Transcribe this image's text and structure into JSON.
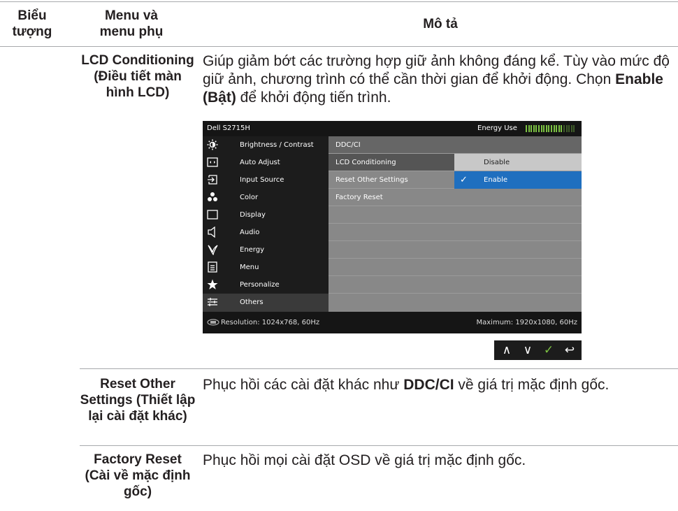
{
  "header": {
    "col1": "Biểu tượng",
    "col2": "Menu và menu phụ",
    "col3": "Mô tả"
  },
  "rows": [
    {
      "label": "LCD Conditioning (Điều tiết màn hình LCD)",
      "desc_pre": "Giúp giảm bớt các trường hợp giữ ảnh không đáng kể. Tùy vào mức độ giữ ảnh, chương trình có thể cần thời gian để khởi động. Chọn ",
      "desc_bold": "Enable (Bật)",
      "desc_post": " để khởi động tiến trình."
    },
    {
      "label": "Reset Other Settings (Thiết lập lại cài đặt khác)",
      "desc_pre": "Phục hồi các cài đặt khác như ",
      "desc_bold": "DDC/CI",
      "desc_post": " về giá trị mặc định gốc."
    },
    {
      "label": "Factory Reset (Cài về mặc định gốc)",
      "desc_pre": "Phục hồi mọi cài đặt OSD về giá trị mặc định gốc.",
      "desc_bold": "",
      "desc_post": ""
    }
  ],
  "osd": {
    "title": "Dell S2715H",
    "energy_label": "Energy Use",
    "energy_level": 0.75,
    "menu": [
      {
        "label": "Brightness / Contrast",
        "icon": "brightness-icon"
      },
      {
        "label": "Auto Adjust",
        "icon": "auto-adjust-icon"
      },
      {
        "label": "Input Source",
        "icon": "input-source-icon"
      },
      {
        "label": "Color",
        "icon": "color-icon"
      },
      {
        "label": "Display",
        "icon": "display-icon"
      },
      {
        "label": "Audio",
        "icon": "audio-icon"
      },
      {
        "label": "Energy",
        "icon": "energy-icon"
      },
      {
        "label": "Menu",
        "icon": "menu-icon"
      },
      {
        "label": "Personalize",
        "icon": "star-icon"
      },
      {
        "label": "Others",
        "icon": "others-icon"
      }
    ],
    "submenu": {
      "ddc": "DDC/CI",
      "lcd": "LCD Conditioning",
      "lcd_value": "Disable",
      "reset_other": "Reset Other Settings",
      "enable": "Enable",
      "factory": "Factory Reset"
    },
    "resolution": "Resolution: 1024x768, 60Hz",
    "maximum": "Maximum: 1920x1080, 60Hz",
    "colors": {
      "selected": "#1f6fbf",
      "highlight": "#c8c8c8",
      "grey": "#888888"
    }
  },
  "buttons": [
    {
      "name": "up-button",
      "icon": "chevron-up-icon",
      "glyph": "∧"
    },
    {
      "name": "down-button",
      "icon": "chevron-down-icon",
      "glyph": "∨"
    },
    {
      "name": "ok-button",
      "icon": "check-icon",
      "glyph": "✓"
    },
    {
      "name": "back-button",
      "icon": "back-icon",
      "glyph": "↩"
    }
  ]
}
